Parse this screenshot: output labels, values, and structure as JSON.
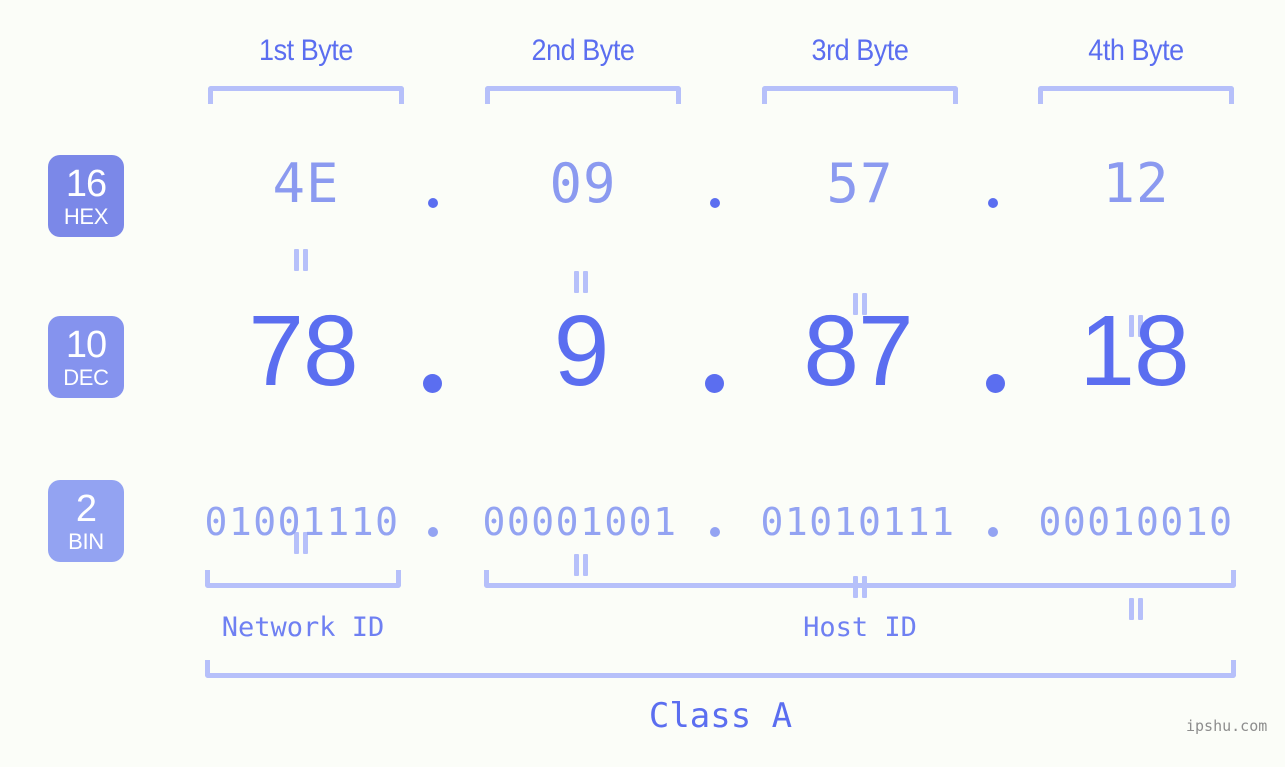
{
  "background_color": "#fbfdf8",
  "accent_color": "#5b6ef0",
  "byte_headers": [
    {
      "label": "1st Byte"
    },
    {
      "label": "2nd Byte"
    },
    {
      "label": "3rd Byte"
    },
    {
      "label": "4th Byte"
    }
  ],
  "rows": [
    {
      "badge_number": "16",
      "badge_name": "HEX",
      "badge_color": "#7b88e8",
      "values": [
        "4E",
        "09",
        "57",
        "12"
      ],
      "separator": "."
    },
    {
      "badge_number": "10",
      "badge_name": "DEC",
      "badge_color": "#8593ee",
      "values": [
        "78",
        "9",
        "87",
        "18"
      ],
      "separator": "."
    },
    {
      "badge_number": "2",
      "badge_name": "BIN",
      "badge_color": "#93a3f2",
      "values": [
        "01001110",
        "00001001",
        "01010111",
        "00010010"
      ],
      "separator": "."
    }
  ],
  "equality_marker": "=",
  "segments": {
    "network_id": "Network ID",
    "host_id": "Host ID"
  },
  "class_label": "Class A",
  "watermark": "ipshu.com"
}
